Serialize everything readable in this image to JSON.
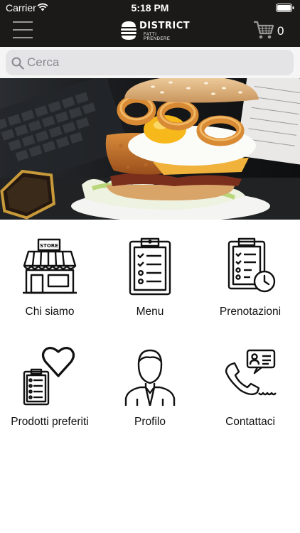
{
  "status_bar": {
    "carrier": "Carrier",
    "time": "5:18 PM"
  },
  "nav": {
    "brand": "DISTRICT",
    "tagline": "FATTI PRENDERE",
    "cart_count": "0"
  },
  "search": {
    "placeholder": "Cerca"
  },
  "colors": {
    "header": "#1c1a18",
    "search_bg": "#e4e3e6",
    "text": "#111111"
  },
  "menu": [
    {
      "label": "Chi siamo",
      "icon": "store-icon"
    },
    {
      "label": "Menu",
      "icon": "clipboard-list-icon"
    },
    {
      "label": "Prenotazioni",
      "icon": "clipboard-clock-icon"
    },
    {
      "label": "Prodotti preferiti",
      "icon": "heart-list-icon"
    },
    {
      "label": "Profilo",
      "icon": "user-icon"
    },
    {
      "label": "Contattaci",
      "icon": "phone-contact-icon"
    }
  ]
}
